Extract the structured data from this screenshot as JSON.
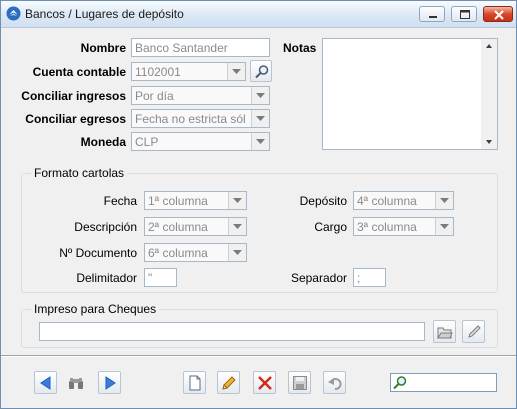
{
  "window": {
    "title": "Bancos / Lugares de depósito"
  },
  "fields": {
    "nombre": {
      "label": "Nombre",
      "value": "Banco Santander"
    },
    "cuenta_contable": {
      "label": "Cuenta contable",
      "value": "1102001"
    },
    "conciliar_ingresos": {
      "label": "Conciliar ingresos",
      "value": "Por día"
    },
    "conciliar_egresos": {
      "label": "Conciliar egresos",
      "value": "Fecha no estricta sól"
    },
    "moneda": {
      "label": "Moneda",
      "value": "CLP"
    },
    "notas": {
      "label": "Notas",
      "value": ""
    }
  },
  "formato_cartolas": {
    "title": "Formato cartolas",
    "fecha": {
      "label": "Fecha",
      "value": "1ª columna"
    },
    "descripcion": {
      "label": "Descripción",
      "value": "2ª columna"
    },
    "nro_documento": {
      "label": "Nº Documento",
      "value": "6ª columna"
    },
    "deposito": {
      "label": "Depósito",
      "value": "4ª columna"
    },
    "cargo": {
      "label": "Cargo",
      "value": "3ª columna"
    },
    "delimitador": {
      "label": "Delimitador",
      "value": "\""
    },
    "separador": {
      "label": "Separador",
      "value": ";"
    }
  },
  "impreso_cheques": {
    "title": "Impreso para Cheques",
    "value": ""
  },
  "toolbar": {
    "icons": [
      "prev-arrow-icon",
      "binoculars-icon",
      "next-arrow-icon",
      "new-document-icon",
      "edit-pencil-icon",
      "delete-x-icon",
      "save-disk-icon",
      "undo-icon"
    ]
  },
  "search": {
    "value": "",
    "icon": "magnifier-icon"
  },
  "colors": {
    "accent": "#3b7ddd",
    "delete": "#d42a1c",
    "close_button": "#d9472a"
  }
}
